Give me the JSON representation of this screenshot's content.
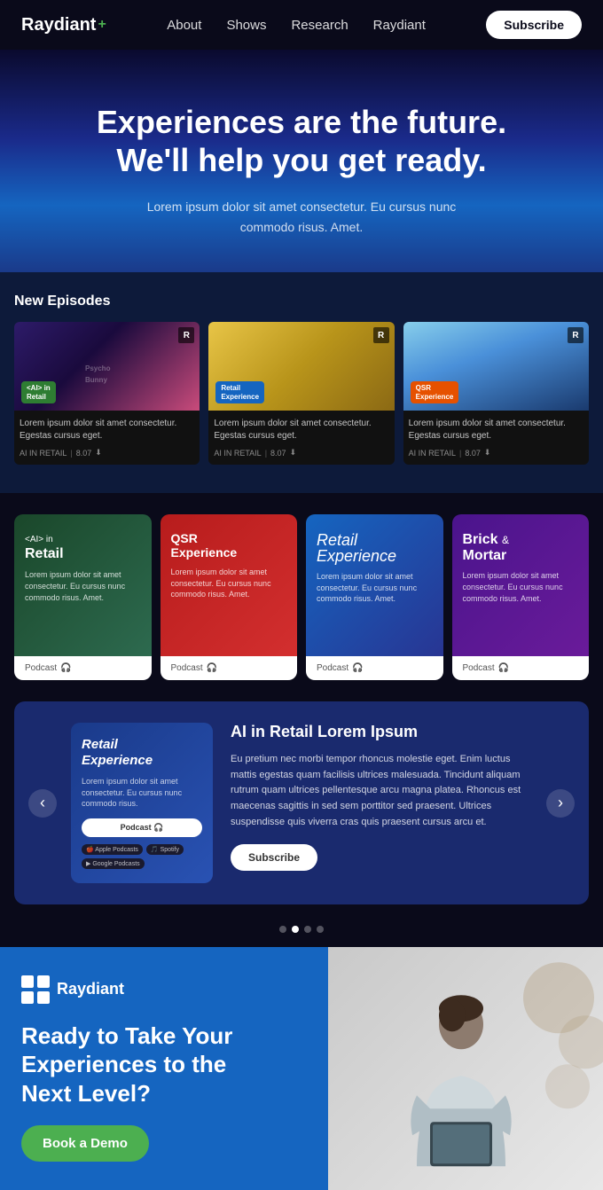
{
  "nav": {
    "logo": "Raydiant",
    "logo_plus": "+",
    "links": [
      "About",
      "Shows",
      "Research",
      "Raydiant"
    ],
    "subscribe_label": "Subscribe"
  },
  "hero": {
    "title_line1": "Experiences are the future.",
    "title_line2": "We'll help you get ready.",
    "subtitle": "Lorem ipsum dolor sit amet consectetur. Eu cursus nunc commodo risus. Amet."
  },
  "new_episodes": {
    "section_title": "New Episodes",
    "episodes": [
      {
        "badge_label": "<AI> in\nRetail",
        "badge_class": "badge-green",
        "r_label": "R",
        "desc": "Lorem ipsum dolor sit amet consectetur. Egestas cursus eget.",
        "tag": "AI IN RETAIL",
        "duration": "8.07"
      },
      {
        "badge_label": "Retail\nExperience",
        "badge_class": "badge-blue",
        "r_label": "R",
        "desc": "Lorem ipsum dolor sit amet consectetur. Egestas cursus eget.",
        "tag": "AI IN RETAIL",
        "duration": "8.07"
      },
      {
        "badge_label": "QSR\nExperience",
        "badge_class": "badge-orange",
        "r_label": "R",
        "desc": "Lorem ipsum dolor sit amet consectetur. Egestas cursus eget.",
        "tag": "AI IN RETAIL",
        "duration": "8.07"
      }
    ]
  },
  "shows": [
    {
      "title": "<AI> in\nRetail",
      "card_class": "show-card-green",
      "desc": "Lorem ipsum dolor sit amet consectetur. Eu cursus nunc commodo risus. Amet.",
      "podcast_label": "Podcast"
    },
    {
      "title": "QSR\nExperience",
      "card_class": "show-card-red",
      "desc": "Lorem ipsum dolor sit amet consectetur. Eu cursus nunc commodo risus. Amet.",
      "podcast_label": "Podcast"
    },
    {
      "title": "Retail\nExperience",
      "card_class": "show-card-blue",
      "desc": "Lorem ipsum dolor sit amet consectetur. Eu cursus nunc commodo risus. Amet.",
      "podcast_label": "Podcast"
    },
    {
      "title": "Brick &\nMortar",
      "card_class": "show-card-purple",
      "desc": "Lorem ipsum dolor sit amet consectetur. Eu cursus nunc commodo risus. Amet.",
      "podcast_label": "Podcast"
    }
  ],
  "carousel": {
    "featured_title": "AI in Retail Lorem Ipsum",
    "featured_text": "Eu pretium nec morbi tempor rhoncus molestie eget. Enim luctus mattis egestas quam facilisis ultrices malesuada. Tincidunt aliquam rutrum quam ultrices pellentesque arcu magna platea. Rhoncus est maecenas sagittis in sed sem porttitor sed praesent. Ultrices suspendisse quis viverra cras quis praesent cursus arcu et.",
    "subscribe_label": "Subscribe",
    "podcast_card_title": "Retail\nExperience",
    "podcast_card_desc": "Lorem ipsum dolor sit amet consectetur. Eu cursus nunc commodo risus.",
    "podcast_btn": "Podcast 🎧",
    "platforms": [
      "🍎 Apple Podcasts",
      "🎵 Spotify",
      "▶ Google Podcasts"
    ],
    "dots": [
      false,
      true,
      false,
      false
    ],
    "prev_arrow": "‹",
    "next_arrow": "›"
  },
  "cta": {
    "logo_text": "Raydiant",
    "heading_line1": "Ready to Take Your",
    "heading_line2": "Experiences to the",
    "heading_line3": "Next Level?",
    "btn_label": "Book a Demo"
  }
}
